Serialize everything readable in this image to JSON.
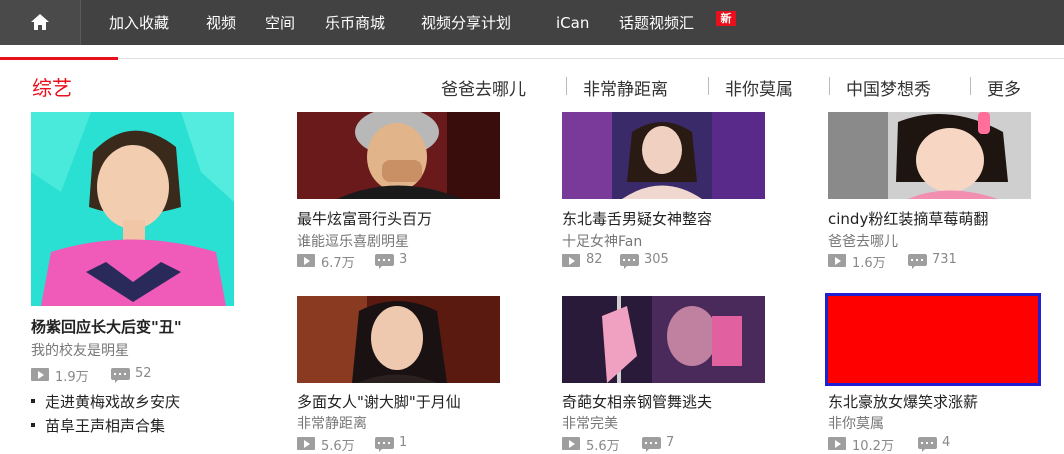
{
  "nav": {
    "home_icon": "home-icon",
    "items": [
      "加入收藏",
      "视频",
      "空间",
      "乐币商城",
      "视频分享计划",
      "iCan",
      "话题视频汇"
    ],
    "badge": "新"
  },
  "section": {
    "title": "综艺",
    "links": [
      "爸爸去哪儿",
      "非常静距离",
      "非你莫属",
      "中国梦想秀",
      "更多"
    ]
  },
  "colors": {
    "accent": "#e8101c",
    "nav_bg": "#424242",
    "highlight_border": "#2020d0"
  },
  "featured": {
    "title": "杨紫回应长大后变\"丑\"",
    "subtitle": "我的校友是明星",
    "plays": "1.9万",
    "comments": "52",
    "list": [
      "走进黄梅戏故乡安庆",
      "苗阜王声相声合集"
    ]
  },
  "cards": [
    {
      "title": "最牛炫富哥行头百万",
      "subtitle": "谁能逗乐喜剧明星",
      "plays": "6.7万",
      "comments": "3"
    },
    {
      "title": "东北毒舌男疑女神整容",
      "subtitle": "十足女神Fan",
      "plays": "82",
      "comments": "305"
    },
    {
      "title": "cindy粉红装摘草莓萌翻",
      "subtitle": "爸爸去哪儿",
      "plays": "1.6万",
      "comments": "731"
    },
    {
      "title": "多面女人\"谢大脚\"于月仙",
      "subtitle": "非常静距离",
      "plays": "5.6万",
      "comments": "1"
    },
    {
      "title": "奇葩女相亲钢管舞逃夫",
      "subtitle": "非常完美",
      "plays": "5.6万",
      "comments": "7"
    },
    {
      "title": "东北豪放女爆笑求涨薪",
      "subtitle": "非你莫属",
      "plays": "10.2万",
      "comments": "4"
    }
  ]
}
